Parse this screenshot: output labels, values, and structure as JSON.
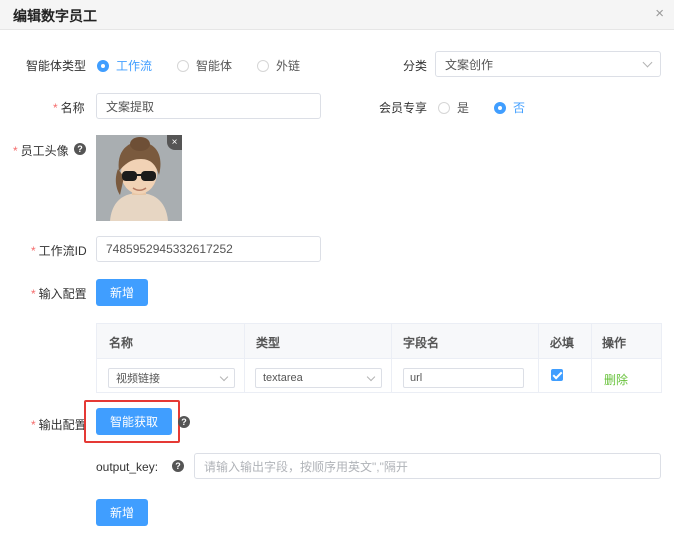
{
  "dialog": {
    "title": "编辑数字员工",
    "close_icon": "×"
  },
  "form": {
    "agent_type": {
      "label": "智能体类型",
      "options": [
        "工作流",
        "智能体",
        "外链"
      ],
      "selected": "工作流"
    },
    "category": {
      "label": "分类",
      "value": "文案创作"
    },
    "name": {
      "required_mark": "*",
      "label": "名称",
      "value": "文案提取"
    },
    "member_only": {
      "label": "会员专享",
      "options": [
        "是",
        "否"
      ],
      "selected": "否"
    },
    "avatar": {
      "required_mark": "*",
      "label": "员工头像",
      "help_icon": "?",
      "remove_icon": "×"
    },
    "workflow_id": {
      "required_mark": "*",
      "label": "工作流ID",
      "value": "7485952945332617252"
    },
    "input_config": {
      "required_mark": "*",
      "label": "输入配置",
      "add_button": "新增",
      "columns": [
        "名称",
        "类型",
        "字段名",
        "必填",
        "操作"
      ],
      "rows": [
        {
          "name": "视频链接",
          "type": "textarea",
          "field": "url",
          "required": true,
          "action": "删除"
        }
      ]
    },
    "output_config": {
      "required_mark": "*",
      "label": "输出配置",
      "smart_button": "智能获取",
      "help_icon": "?",
      "output_key_label": "output_key:",
      "output_key_placeholder": "请输入输出字段，按顺序用英文\",\"隔开",
      "add_button": "新增"
    }
  },
  "colors": {
    "primary": "#409eff",
    "required": "#f56c6c",
    "delete_link": "#67c23a",
    "highlight": "#e53935"
  }
}
